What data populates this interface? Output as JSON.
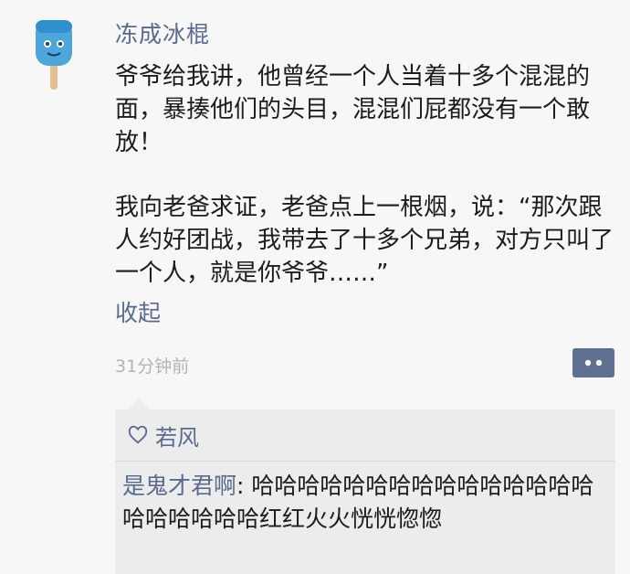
{
  "post": {
    "author": "冻成冰棍",
    "paragraph1": "爷爷给我讲，他曾经一个人当着十多个混混的面，暴揍他们的头目，混混们屁都没有一个敢放！",
    "paragraph2": "我向老爸求证，老爸点上一根烟，说：“那次跟人约好团战，我带去了十多个兄弟，对方只叫了一个人，就是你爷爷……”",
    "collapse_label": "收起",
    "timestamp": "31分钟前"
  },
  "likes": {
    "names": "若风"
  },
  "comments": [
    {
      "author": "是鬼才君啊",
      "separator": ": ",
      "text": "哈哈哈哈哈哈哈哈哈哈哈哈哈哈哈哈哈哈哈哈哈红红火火恍恍惚惚"
    }
  ],
  "colors": {
    "link": "#5b6b8e",
    "avatar_popsicle": "#4ea6dd",
    "comment_bg": "#ececec",
    "comment_button_bg": "#5f6f8f"
  },
  "icons": {
    "avatar": "blue-popsicle-avatar",
    "like": "heart-outline-icon",
    "comment_button": "comment-dots-icon"
  }
}
